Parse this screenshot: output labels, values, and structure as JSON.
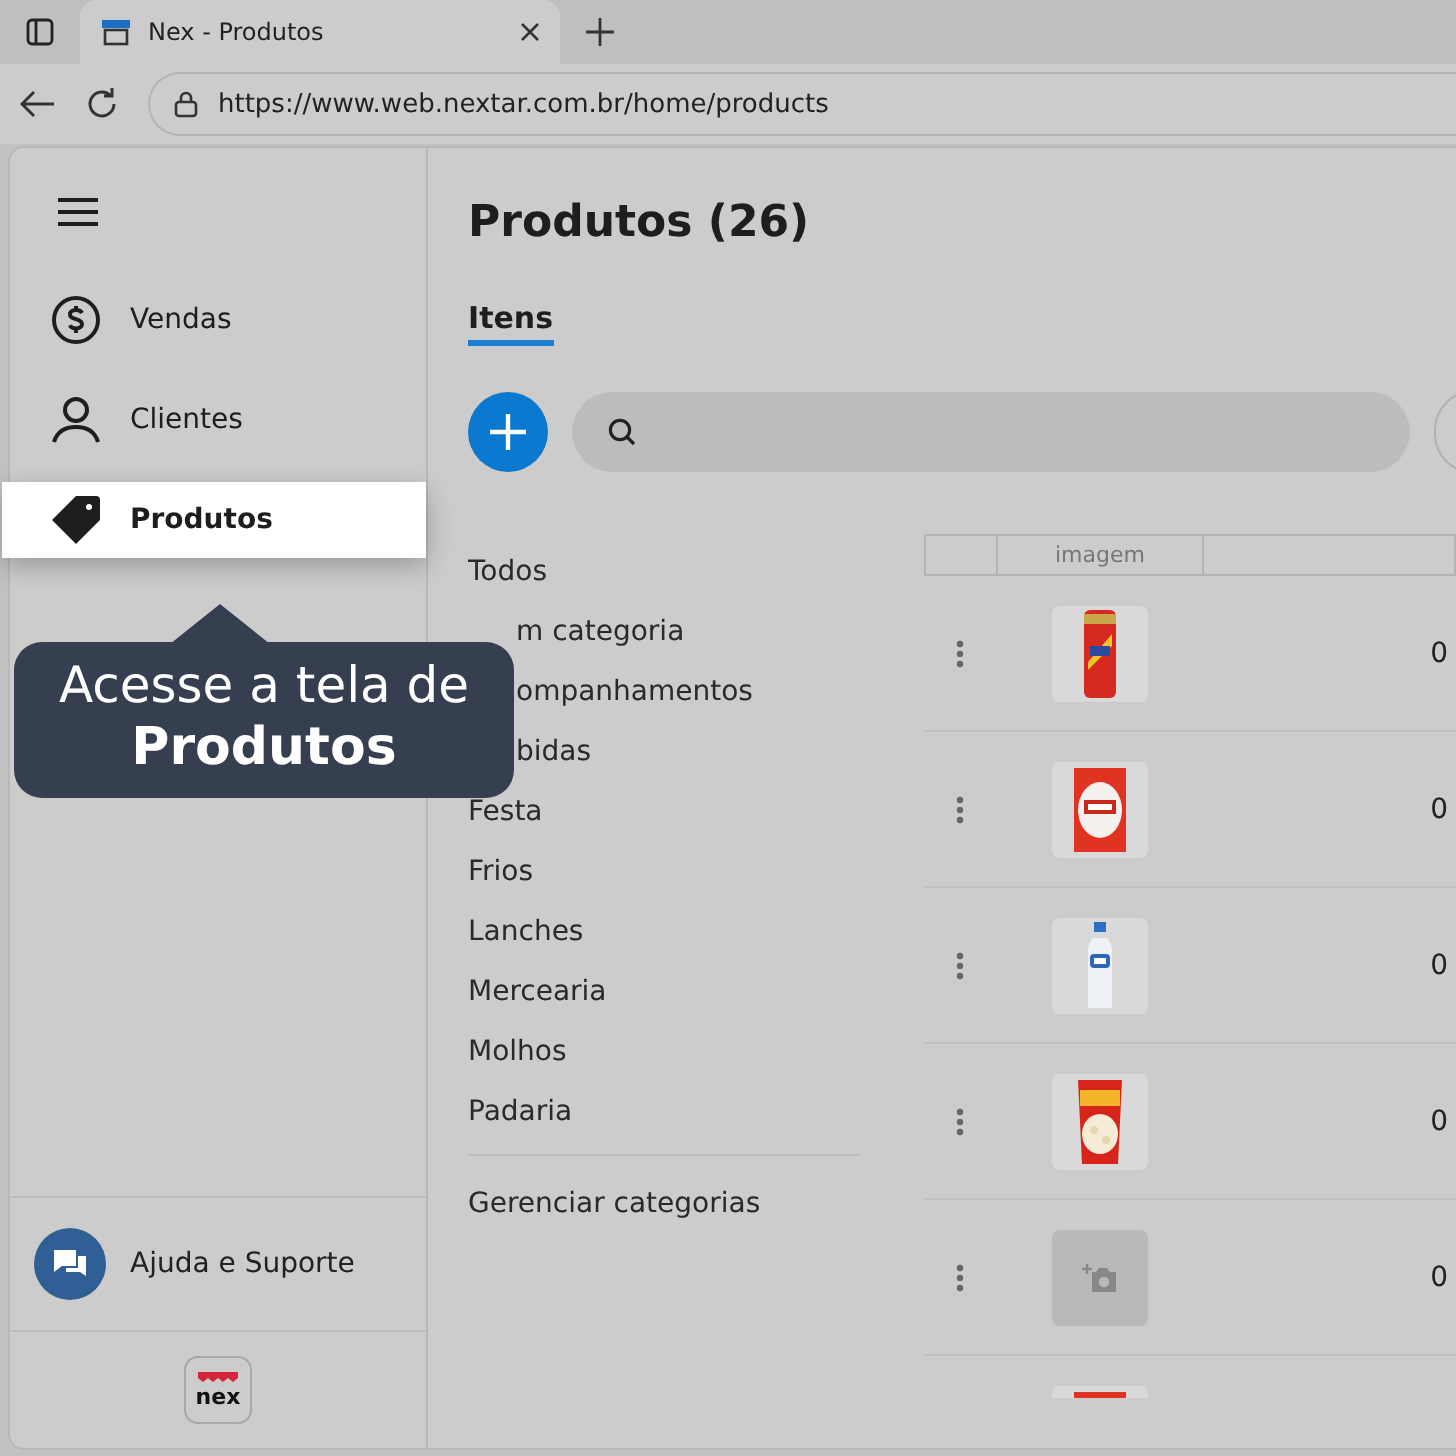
{
  "browser": {
    "tab_title": "Nex - Produtos",
    "url": "https://www.web.nextar.com.br/home/products"
  },
  "sidebar": {
    "items": [
      {
        "label": "Vendas",
        "selected": false
      },
      {
        "label": "Clientes",
        "selected": false
      },
      {
        "label": "Produtos",
        "selected": true
      }
    ],
    "help": "Ajuda e Suporte",
    "logo": "nex"
  },
  "tooltip": {
    "text": "Acesse a tela de **Produtos**"
  },
  "page": {
    "title": "Produtos (26)",
    "tabs": [
      {
        "label": "Itens",
        "selected": true
      }
    ]
  },
  "categories": [
    {
      "label": "Todos",
      "covered": false
    },
    {
      "label": "m categoria",
      "covered": true
    },
    {
      "label": "ompanhamentos",
      "covered": true
    },
    {
      "label": "bidas",
      "covered": true
    },
    {
      "label": "Festa",
      "covered": false
    },
    {
      "label": "Frios",
      "covered": false
    },
    {
      "label": "Lanches",
      "covered": false
    },
    {
      "label": "Mercearia",
      "covered": false
    },
    {
      "label": "Molhos",
      "covered": false
    },
    {
      "label": "Padaria",
      "covered": false
    }
  ],
  "manage_categories": "Gerenciar categorias",
  "table": {
    "columns": [
      "imagem"
    ],
    "rows": [
      {
        "kind": "picture",
        "value": "0"
      },
      {
        "kind": "picture",
        "value": "0"
      },
      {
        "kind": "picture",
        "value": "0"
      },
      {
        "kind": "picture",
        "value": "0"
      },
      {
        "kind": "empty",
        "value": "0"
      },
      {
        "kind": "picture"
      }
    ]
  }
}
